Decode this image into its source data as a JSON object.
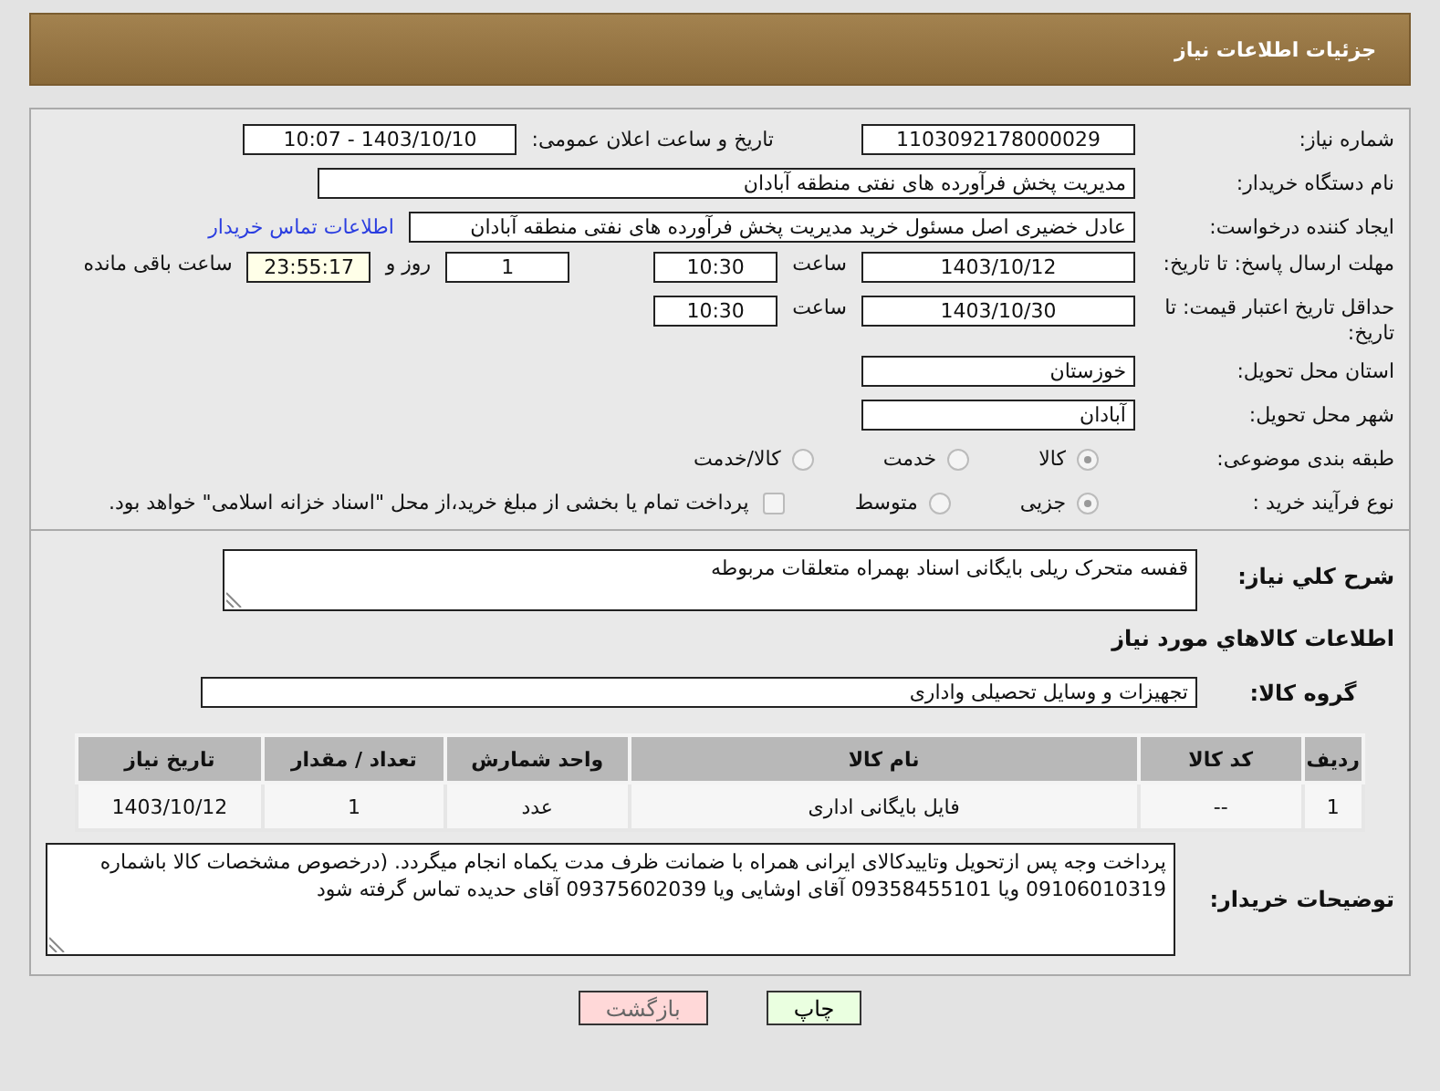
{
  "header": {
    "title": "جزئیات اطلاعات نیاز"
  },
  "need_number": {
    "label": "شماره نیاز:",
    "value": "1103092178000029"
  },
  "announce": {
    "label": "تاریخ و ساعت اعلان عمومی:",
    "value": "1403/10/10 - 10:07"
  },
  "buyer_org": {
    "label": "نام دستگاه خریدار:",
    "value": "مدیریت پخش فرآورده های نفتی منطقه آبادان"
  },
  "requester": {
    "label": "ایجاد کننده درخواست:",
    "value": "عادل خضیری اصل مسئول خرید مدیریت پخش فرآورده های نفتی منطقه آبادان",
    "link": "اطلاعات تماس خریدار"
  },
  "reply_deadline": {
    "label": "مهلت ارسال پاسخ: تا تاریخ:",
    "date": "1403/10/12",
    "time_label": "ساعت",
    "time": "10:30",
    "days": "1",
    "days_label": "روز و",
    "remaining": "23:55:17",
    "remaining_label": "ساعت باقی مانده"
  },
  "price_validity": {
    "label": "حداقل تاریخ اعتبار قیمت: تا تاریخ:",
    "date": "1403/10/30",
    "time_label": "ساعت",
    "time": "10:30"
  },
  "province": {
    "label": "استان محل تحویل:",
    "value": "خوزستان"
  },
  "city": {
    "label": "شهر محل تحویل:",
    "value": "آبادان"
  },
  "category": {
    "label": "طبقه بندی موضوعی:",
    "options": [
      {
        "label": "کالا",
        "selected": true
      },
      {
        "label": "خدمت",
        "selected": false
      },
      {
        "label": "کالا/خدمت",
        "selected": false
      }
    ]
  },
  "purchase_process": {
    "label": "نوع فرآیند خرید :",
    "options": [
      {
        "label": "جزیی",
        "selected": true
      },
      {
        "label": "متوسط",
        "selected": false
      }
    ],
    "checkbox": {
      "label": "پرداخت تمام یا بخشی از مبلغ خرید،از محل \"اسناد خزانه اسلامی\" خواهد بود.",
      "checked": false
    }
  },
  "description": {
    "label": "شرح كلي نياز:",
    "value": "قفسه متحرک ریلی بایگانی اسناد بهمراه متعلقات مربوطه"
  },
  "goods_heading": "اطلاعات كالاهاي مورد نياز",
  "goods_group": {
    "label": "گروه کالا:",
    "value": "تجهیزات و وسایل تحصیلی واداری"
  },
  "table": {
    "columns": [
      "ردیف",
      "کد کالا",
      "نام کالا",
      "واحد شمارش",
      "تعداد / مقدار",
      "تاریخ نیاز"
    ],
    "rows": [
      [
        "1",
        "--",
        "فایل بایگانی اداری",
        "عدد",
        "1",
        "1403/10/12"
      ]
    ]
  },
  "buyer_notes": {
    "label": "توضیحات خریدار:",
    "value": "پرداخت وجه پس ازتحویل وتاییدکالای ایرانی همراه با ضمانت ظرف مدت یکماه انجام میگردد. (درخصوص مشخصات کالا باشماره\n09106010319 ویا 09358455101 آقای اوشایی ویا 09375602039 آقای حدیده تماس گرفته شود"
  },
  "buttons": [
    {
      "label": "چاپ",
      "kind": "print"
    },
    {
      "label": "بازگشت",
      "kind": "back"
    }
  ]
}
